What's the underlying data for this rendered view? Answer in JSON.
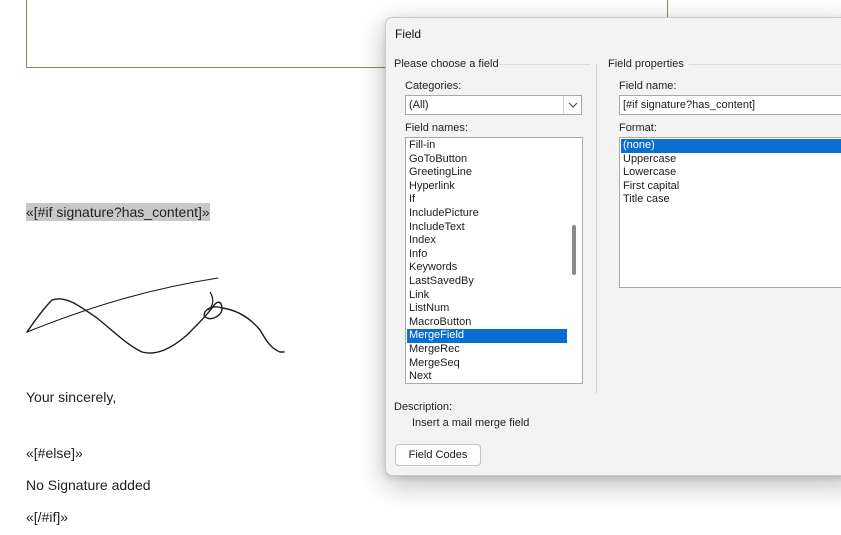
{
  "document": {
    "if_field": "«[#if signature?has_content]»",
    "closing": "Your sincerely,",
    "else_field": "«[#else]»",
    "no_signature": "No Signature added",
    "endif_field": "«[/#if]»"
  },
  "dialog": {
    "title": "Field",
    "left_group_title": "Please choose a field",
    "categories_label": "Categories:",
    "categories_value": "(All)",
    "field_names_label": "Field names:",
    "field_names": [
      "Fill-in",
      "GoToButton",
      "GreetingLine",
      "Hyperlink",
      "If",
      "IncludePicture",
      "IncludeText",
      "Index",
      "Info",
      "Keywords",
      "LastSavedBy",
      "Link",
      "ListNum",
      "MacroButton",
      "MergeField",
      "MergeRec",
      "MergeSeq",
      "Next"
    ],
    "selected_field": "MergeField",
    "right_group_title": "Field properties",
    "field_name_label": "Field name:",
    "field_name_value": "[#if signature?has_content]",
    "format_label": "Format:",
    "formats": [
      "(none)",
      "Uppercase",
      "Lowercase",
      "First capital",
      "Title case"
    ],
    "selected_format": "(none)",
    "description_label": "Description:",
    "description_text": "Insert a mail merge field",
    "field_codes_button": "Field Codes"
  },
  "colors": {
    "selection": "#0a6fd1",
    "dialog_bg": "#f3f3f3",
    "field_highlight": "#c8c8c8"
  }
}
